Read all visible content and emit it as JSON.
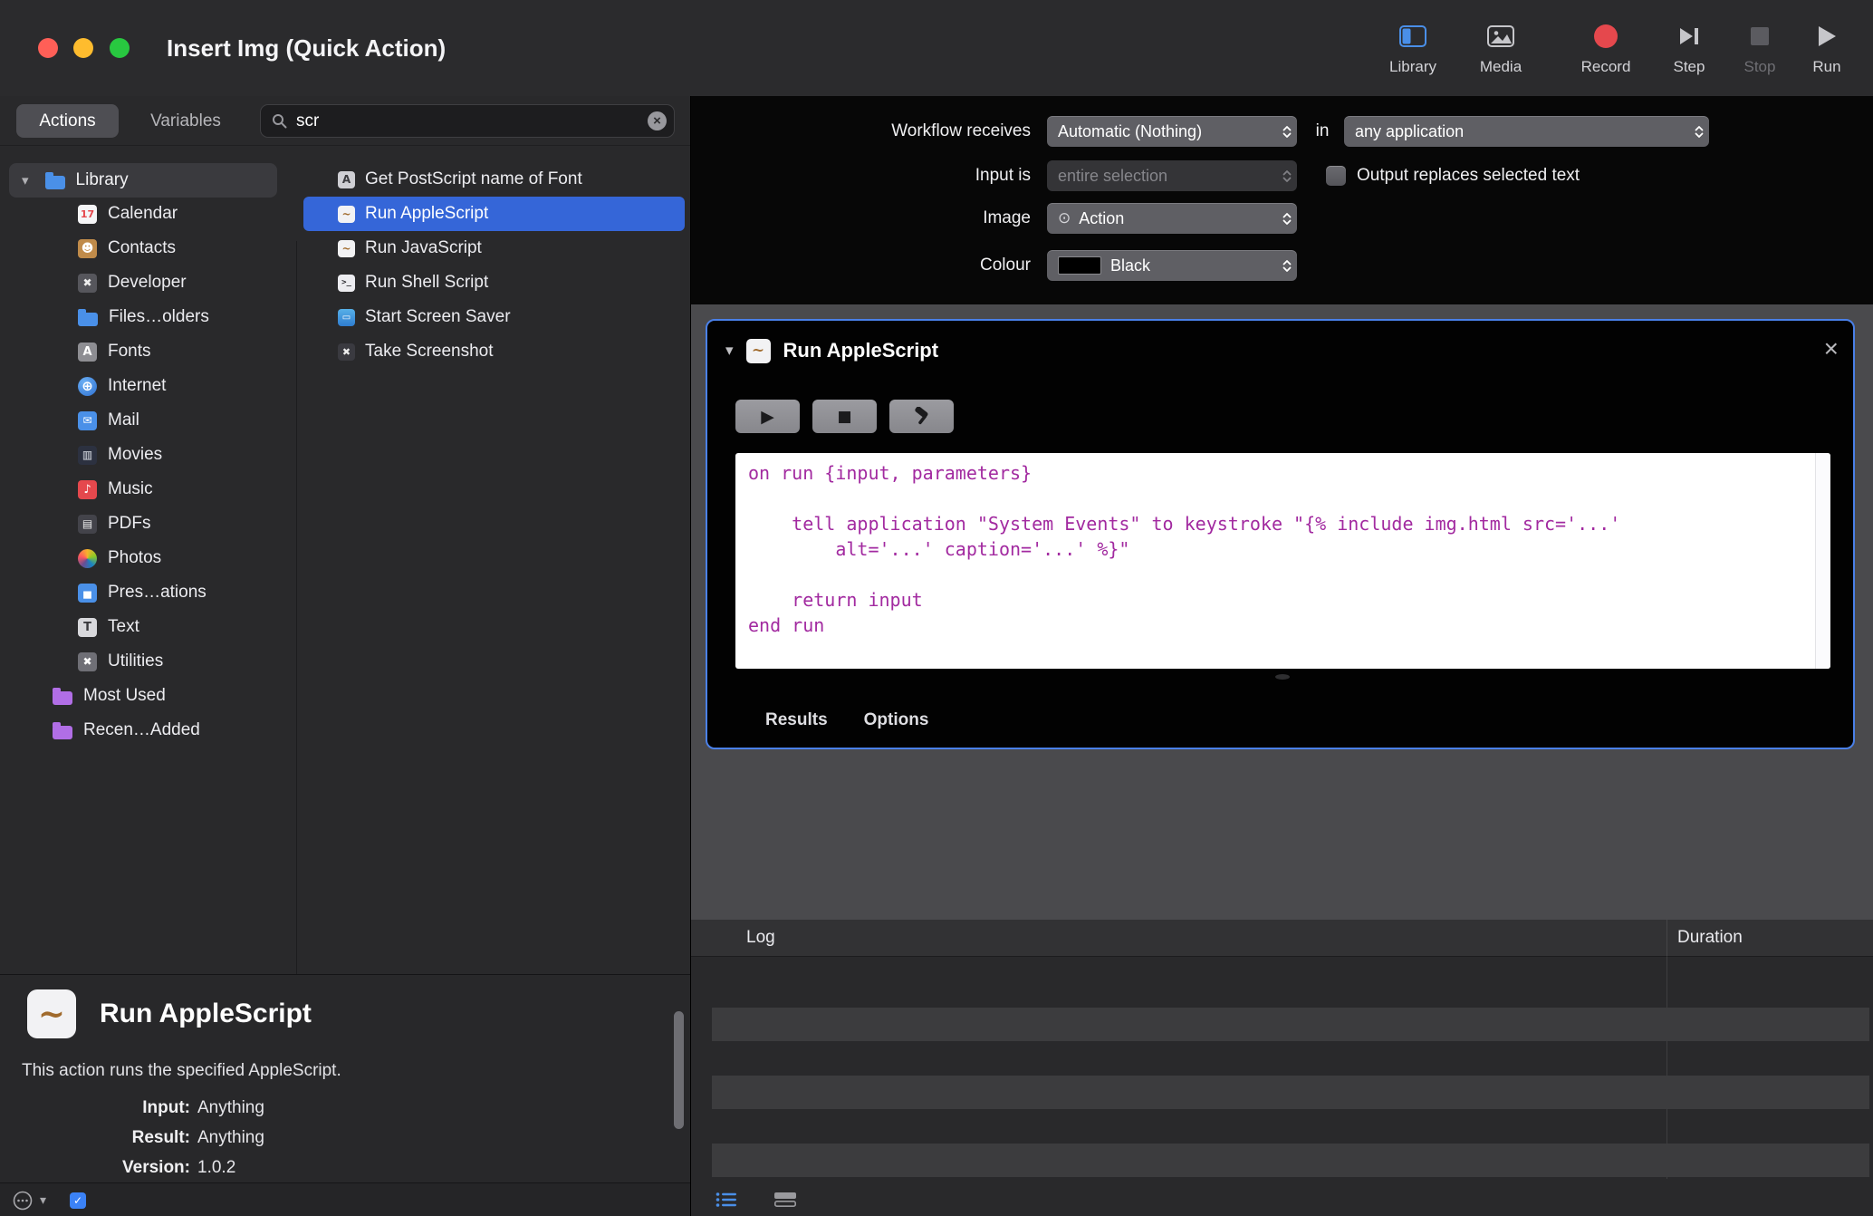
{
  "titlebar": {
    "title": "Insert Img (Quick Action)",
    "traffic_lights": [
      "close",
      "minimize",
      "zoom"
    ],
    "toolbar": [
      {
        "id": "library",
        "label": "Library",
        "icon": "sidebar-icon",
        "disabled": false
      },
      {
        "id": "media",
        "label": "Media",
        "icon": "media-icon",
        "disabled": false
      },
      {
        "id": "record",
        "label": "Record",
        "icon": "record-icon",
        "disabled": false
      },
      {
        "id": "step",
        "label": "Step",
        "icon": "step-icon",
        "disabled": false
      },
      {
        "id": "stop",
        "label": "Stop",
        "icon": "stop-icon",
        "disabled": true
      },
      {
        "id": "run",
        "label": "Run",
        "icon": "run-icon",
        "disabled": false
      }
    ]
  },
  "left_panel": {
    "tabs": [
      {
        "label": "Actions",
        "selected": true
      },
      {
        "label": "Variables",
        "selected": false
      }
    ],
    "search": {
      "value": "scr",
      "icon": "search-icon",
      "clear_icon": "clear-icon"
    },
    "sidebar": {
      "root": {
        "label": "Library",
        "icon": "library-folder-icon",
        "expanded": true
      },
      "items": [
        {
          "label": "Calendar",
          "icon": "calendar-icon"
        },
        {
          "label": "Contacts",
          "icon": "contacts-icon"
        },
        {
          "label": "Developer",
          "icon": "developer-icon"
        },
        {
          "label": "Files…olders",
          "icon": "folder-icon"
        },
        {
          "label": "Fonts",
          "icon": "fonts-icon"
        },
        {
          "label": "Internet",
          "icon": "internet-icon"
        },
        {
          "label": "Mail",
          "icon": "mail-icon"
        },
        {
          "label": "Movies",
          "icon": "movies-icon"
        },
        {
          "label": "Music",
          "icon": "music-icon"
        },
        {
          "label": "PDFs",
          "icon": "pdfs-icon"
        },
        {
          "label": "Photos",
          "icon": "photos-icon"
        },
        {
          "label": "Pres…ations",
          "icon": "presentations-icon"
        },
        {
          "label": "Text",
          "icon": "text-icon"
        },
        {
          "label": "Utilities",
          "icon": "utilities-icon"
        }
      ],
      "groups": [
        {
          "label": "Most Used",
          "icon": "smart-folder-icon"
        },
        {
          "label": "Recen…Added",
          "icon": "smart-folder-icon"
        }
      ]
    },
    "results": [
      {
        "label": "Get PostScript name of Font",
        "icon": "font-action-icon",
        "selected": false
      },
      {
        "label": "Run AppleScript",
        "icon": "applescript-icon",
        "selected": true
      },
      {
        "label": "Run JavaScript",
        "icon": "javascript-icon",
        "selected": false
      },
      {
        "label": "Run Shell Script",
        "icon": "shell-icon",
        "selected": false
      },
      {
        "label": "Start Screen Saver",
        "icon": "screensaver-icon",
        "selected": false
      },
      {
        "label": "Take Screenshot",
        "icon": "screenshot-icon",
        "selected": false
      }
    ],
    "description": {
      "icon": "applescript-icon",
      "title": "Run AppleScript",
      "text": "This action runs the specified AppleScript.",
      "fields": [
        {
          "label": "Input:",
          "value": "Anything"
        },
        {
          "label": "Result:",
          "value": "Anything"
        },
        {
          "label": "Version:",
          "value": "1.0.2"
        }
      ]
    }
  },
  "workflow": {
    "config": {
      "receives_label": "Workflow receives",
      "receives_popup": "Automatic (Nothing)",
      "receives_conjunction": "in",
      "application_popup": "any application",
      "input_label": "Input is",
      "input_popup": "entire selection",
      "input_popup_disabled": true,
      "checkbox_label": "Output replaces selected text",
      "checkbox_checked": false,
      "image_label": "Image",
      "image_popup": "Action",
      "image_popup_icon": "action-glyph-icon",
      "colour_label": "Colour",
      "colour_popup": "Black",
      "colour_swatch": "#000000"
    },
    "action": {
      "title": "Run AppleScript",
      "icon": "applescript-icon",
      "chevron_icon": "chevron-down-icon",
      "close_icon": "close-icon",
      "buttons": [
        {
          "id": "run-script",
          "icon": "play-icon"
        },
        {
          "id": "stop-script",
          "icon": "stop-icon"
        },
        {
          "id": "compile-script",
          "icon": "hammer-icon"
        }
      ],
      "code_lines": [
        "on run {input, parameters}",
        "",
        "    tell application \"System Events\" to keystroke \"{% include img.html src='...'",
        "        alt='...' caption='...' %}\"",
        "",
        "    return input",
        "end run"
      ],
      "tabs": [
        {
          "label": "Results"
        },
        {
          "label": "Options"
        }
      ]
    }
  },
  "log_panel": {
    "header": "Log",
    "duration_header": "Duration",
    "empty_rows": 3,
    "view_toggles": [
      {
        "icon": "list-view-icon",
        "active": true
      },
      {
        "icon": "panel-view-icon",
        "active": false
      }
    ]
  },
  "footer": {
    "icons": [
      "media-browser-icon",
      "chevron-down-icon",
      "action-checkbox-icon"
    ]
  },
  "colors": {
    "accent_blue": "#4a80e8",
    "selection_blue": "#3566d8",
    "record_red": "#e5484d",
    "code_text": "#a22aa0",
    "swatch_black": "#000000"
  }
}
